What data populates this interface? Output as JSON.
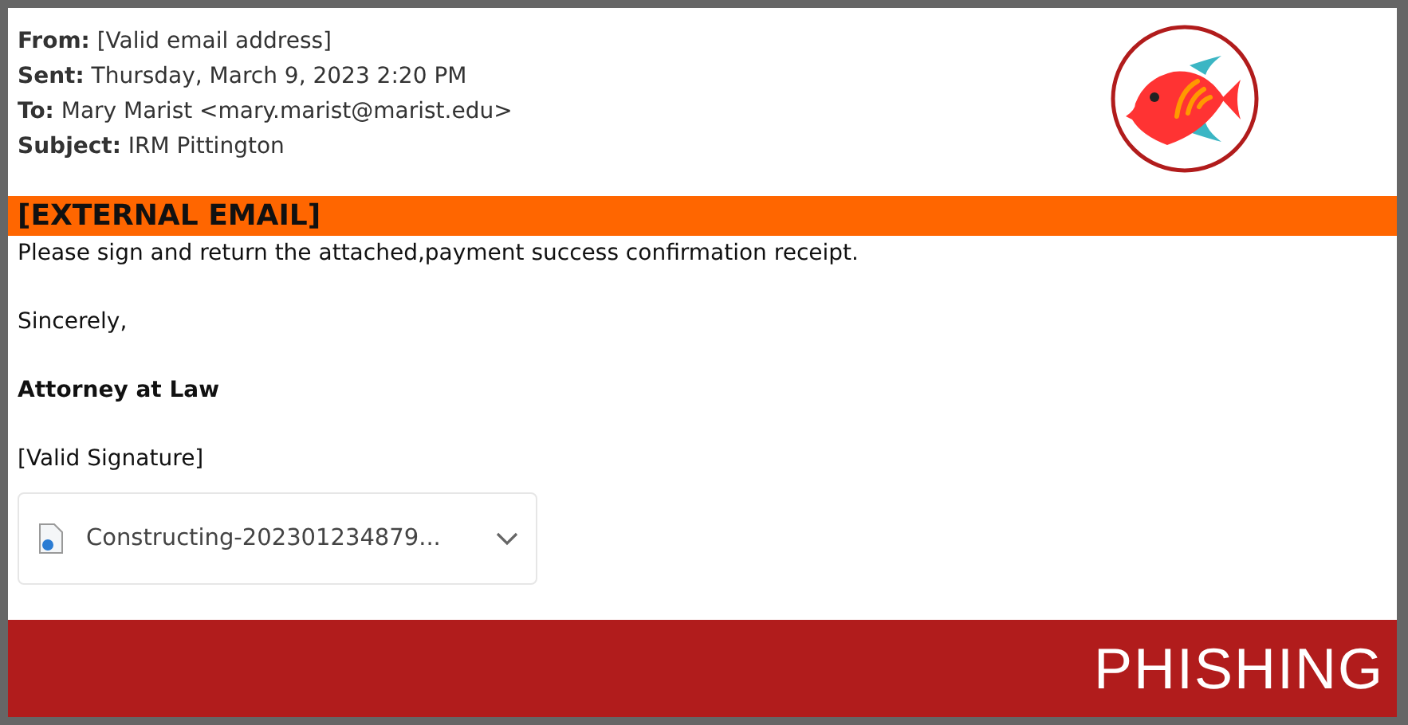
{
  "headers": [
    {
      "label": "From:",
      "value": "[Valid email address]"
    },
    {
      "label": "Sent:",
      "value": "Thursday, March 9, 2023 2:20 PM"
    },
    {
      "label": "To:",
      "value": "Mary Marist <mary.marist@marist.edu>"
    },
    {
      "label": "Subject:",
      "value": "IRM Pittington"
    }
  ],
  "banner": "[EXTERNAL EMAIL]",
  "body": [
    {
      "kind": "text",
      "text": "Please sign and return the attached,payment success confirmation receipt."
    },
    {
      "kind": "text",
      "text": "Sincerely,"
    },
    {
      "kind": "bold",
      "text": "Attorney at Law"
    },
    {
      "kind": "text",
      "text": "[Valid Signature]"
    }
  ],
  "attachment": {
    "name": "Constructing-202301234879..."
  },
  "footer": {
    "label": "PHISHING"
  }
}
